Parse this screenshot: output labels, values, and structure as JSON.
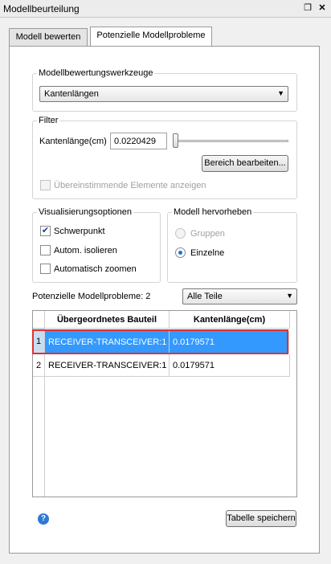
{
  "window": {
    "title": "Modellbeurteilung",
    "restore_icon": "restore-icon",
    "close_icon": "close-icon"
  },
  "tabs": [
    {
      "label": "Modell bewerten",
      "active": false
    },
    {
      "label": "Potenzielle Modellprobleme",
      "active": true
    }
  ],
  "tools": {
    "legend": "Modellbewertungswerkzeuge",
    "selected": "Kantenlängen"
  },
  "filter": {
    "legend": "Filter",
    "edge_length_label": "Kantenlänge(cm)",
    "edge_length_value": "0.0220429",
    "slider_fraction": 0.0,
    "edit_range_button": "Bereich bearbeiten...",
    "show_matching_label": "Übereinstimmende Elemente anzeigen",
    "show_matching_checked": false
  },
  "visualization": {
    "legend": "Visualisierungsoptionen",
    "options": [
      {
        "label": "Schwerpunkt",
        "checked": true
      },
      {
        "label": "Autom. isolieren",
        "checked": false
      },
      {
        "label": "Automatisch zoomen",
        "checked": false
      }
    ]
  },
  "highlight": {
    "legend": "Modell hervorheben",
    "options": [
      {
        "label": "Gruppen",
        "selected": false,
        "disabled": true
      },
      {
        "label": "Einzelne",
        "selected": true,
        "disabled": false
      }
    ]
  },
  "problems": {
    "label": "Potenzielle Modellprobleme: 2",
    "filter_selected": "Alle Teile"
  },
  "table": {
    "columns": [
      "Übergeordnetes Bauteil",
      "Kantenlänge(cm)"
    ],
    "rows": [
      {
        "index": "1",
        "parent": "RECEIVER-TRANSCEIVER:1",
        "edge_length": "0.0179571",
        "selected": true
      },
      {
        "index": "2",
        "parent": "RECEIVER-TRANSCEIVER:1",
        "edge_length": "0.0179571",
        "selected": false
      }
    ]
  },
  "footer": {
    "help_icon": "help-icon",
    "help_glyph": "?",
    "save_table_button": "Tabelle speichern"
  },
  "colors": {
    "selection": "#3399ff",
    "highlight_border": "#e03131",
    "radio_dot": "#1e6fd9"
  }
}
